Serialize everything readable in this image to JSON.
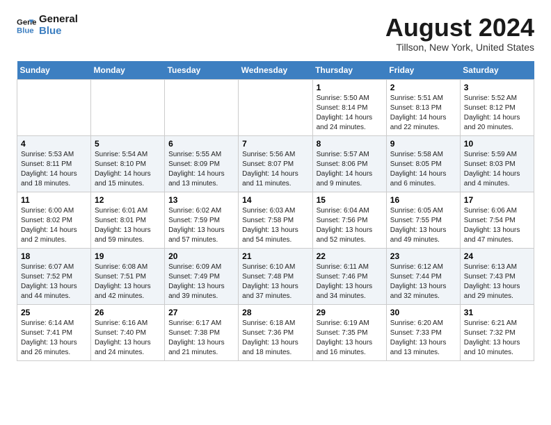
{
  "logo": {
    "line1": "General",
    "line2": "Blue"
  },
  "title": "August 2024",
  "subtitle": "Tillson, New York, United States",
  "days_of_week": [
    "Sunday",
    "Monday",
    "Tuesday",
    "Wednesday",
    "Thursday",
    "Friday",
    "Saturday"
  ],
  "weeks": [
    [
      {
        "day": "",
        "info": ""
      },
      {
        "day": "",
        "info": ""
      },
      {
        "day": "",
        "info": ""
      },
      {
        "day": "",
        "info": ""
      },
      {
        "day": "1",
        "info": "Sunrise: 5:50 AM\nSunset: 8:14 PM\nDaylight: 14 hours and 24 minutes."
      },
      {
        "day": "2",
        "info": "Sunrise: 5:51 AM\nSunset: 8:13 PM\nDaylight: 14 hours and 22 minutes."
      },
      {
        "day": "3",
        "info": "Sunrise: 5:52 AM\nSunset: 8:12 PM\nDaylight: 14 hours and 20 minutes."
      }
    ],
    [
      {
        "day": "4",
        "info": "Sunrise: 5:53 AM\nSunset: 8:11 PM\nDaylight: 14 hours and 18 minutes."
      },
      {
        "day": "5",
        "info": "Sunrise: 5:54 AM\nSunset: 8:10 PM\nDaylight: 14 hours and 15 minutes."
      },
      {
        "day": "6",
        "info": "Sunrise: 5:55 AM\nSunset: 8:09 PM\nDaylight: 14 hours and 13 minutes."
      },
      {
        "day": "7",
        "info": "Sunrise: 5:56 AM\nSunset: 8:07 PM\nDaylight: 14 hours and 11 minutes."
      },
      {
        "day": "8",
        "info": "Sunrise: 5:57 AM\nSunset: 8:06 PM\nDaylight: 14 hours and 9 minutes."
      },
      {
        "day": "9",
        "info": "Sunrise: 5:58 AM\nSunset: 8:05 PM\nDaylight: 14 hours and 6 minutes."
      },
      {
        "day": "10",
        "info": "Sunrise: 5:59 AM\nSunset: 8:03 PM\nDaylight: 14 hours and 4 minutes."
      }
    ],
    [
      {
        "day": "11",
        "info": "Sunrise: 6:00 AM\nSunset: 8:02 PM\nDaylight: 14 hours and 2 minutes."
      },
      {
        "day": "12",
        "info": "Sunrise: 6:01 AM\nSunset: 8:01 PM\nDaylight: 13 hours and 59 minutes."
      },
      {
        "day": "13",
        "info": "Sunrise: 6:02 AM\nSunset: 7:59 PM\nDaylight: 13 hours and 57 minutes."
      },
      {
        "day": "14",
        "info": "Sunrise: 6:03 AM\nSunset: 7:58 PM\nDaylight: 13 hours and 54 minutes."
      },
      {
        "day": "15",
        "info": "Sunrise: 6:04 AM\nSunset: 7:56 PM\nDaylight: 13 hours and 52 minutes."
      },
      {
        "day": "16",
        "info": "Sunrise: 6:05 AM\nSunset: 7:55 PM\nDaylight: 13 hours and 49 minutes."
      },
      {
        "day": "17",
        "info": "Sunrise: 6:06 AM\nSunset: 7:54 PM\nDaylight: 13 hours and 47 minutes."
      }
    ],
    [
      {
        "day": "18",
        "info": "Sunrise: 6:07 AM\nSunset: 7:52 PM\nDaylight: 13 hours and 44 minutes."
      },
      {
        "day": "19",
        "info": "Sunrise: 6:08 AM\nSunset: 7:51 PM\nDaylight: 13 hours and 42 minutes."
      },
      {
        "day": "20",
        "info": "Sunrise: 6:09 AM\nSunset: 7:49 PM\nDaylight: 13 hours and 39 minutes."
      },
      {
        "day": "21",
        "info": "Sunrise: 6:10 AM\nSunset: 7:48 PM\nDaylight: 13 hours and 37 minutes."
      },
      {
        "day": "22",
        "info": "Sunrise: 6:11 AM\nSunset: 7:46 PM\nDaylight: 13 hours and 34 minutes."
      },
      {
        "day": "23",
        "info": "Sunrise: 6:12 AM\nSunset: 7:44 PM\nDaylight: 13 hours and 32 minutes."
      },
      {
        "day": "24",
        "info": "Sunrise: 6:13 AM\nSunset: 7:43 PM\nDaylight: 13 hours and 29 minutes."
      }
    ],
    [
      {
        "day": "25",
        "info": "Sunrise: 6:14 AM\nSunset: 7:41 PM\nDaylight: 13 hours and 26 minutes."
      },
      {
        "day": "26",
        "info": "Sunrise: 6:16 AM\nSunset: 7:40 PM\nDaylight: 13 hours and 24 minutes."
      },
      {
        "day": "27",
        "info": "Sunrise: 6:17 AM\nSunset: 7:38 PM\nDaylight: 13 hours and 21 minutes."
      },
      {
        "day": "28",
        "info": "Sunrise: 6:18 AM\nSunset: 7:36 PM\nDaylight: 13 hours and 18 minutes."
      },
      {
        "day": "29",
        "info": "Sunrise: 6:19 AM\nSunset: 7:35 PM\nDaylight: 13 hours and 16 minutes."
      },
      {
        "day": "30",
        "info": "Sunrise: 6:20 AM\nSunset: 7:33 PM\nDaylight: 13 hours and 13 minutes."
      },
      {
        "day": "31",
        "info": "Sunrise: 6:21 AM\nSunset: 7:32 PM\nDaylight: 13 hours and 10 minutes."
      }
    ]
  ]
}
